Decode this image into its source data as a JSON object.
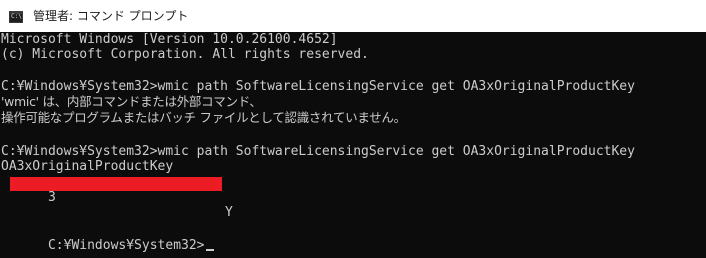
{
  "window": {
    "title": "管理者: コマンド プロンプト",
    "icon": "command-prompt-icon",
    "icon_glyph": "C:\\"
  },
  "console": {
    "banner_line1": "Microsoft Windows [Version 10.0.26100.4652]",
    "banner_line2": "(c) Microsoft Corporation. All rights reserved.",
    "cmd1": "C:¥Windows¥System32>wmic path SoftwareLicensingService get OA3xOriginalProductKey",
    "err_line1": "'wmic' は、内部コマンドまたは外部コマンド、",
    "err_line2": "操作可能なプログラムまたはバッチ ファイルとして認識されていません。",
    "cmd2": "C:¥Windows¥System32>wmic path SoftwareLicensingService get OA3xOriginalProductKey",
    "header": "OA3xOriginalProductKey",
    "key_first_char": "3",
    "key_last_char": "Y",
    "redaction_color": "#ec1c24",
    "prompt": "C:¥Windows¥System32>"
  }
}
